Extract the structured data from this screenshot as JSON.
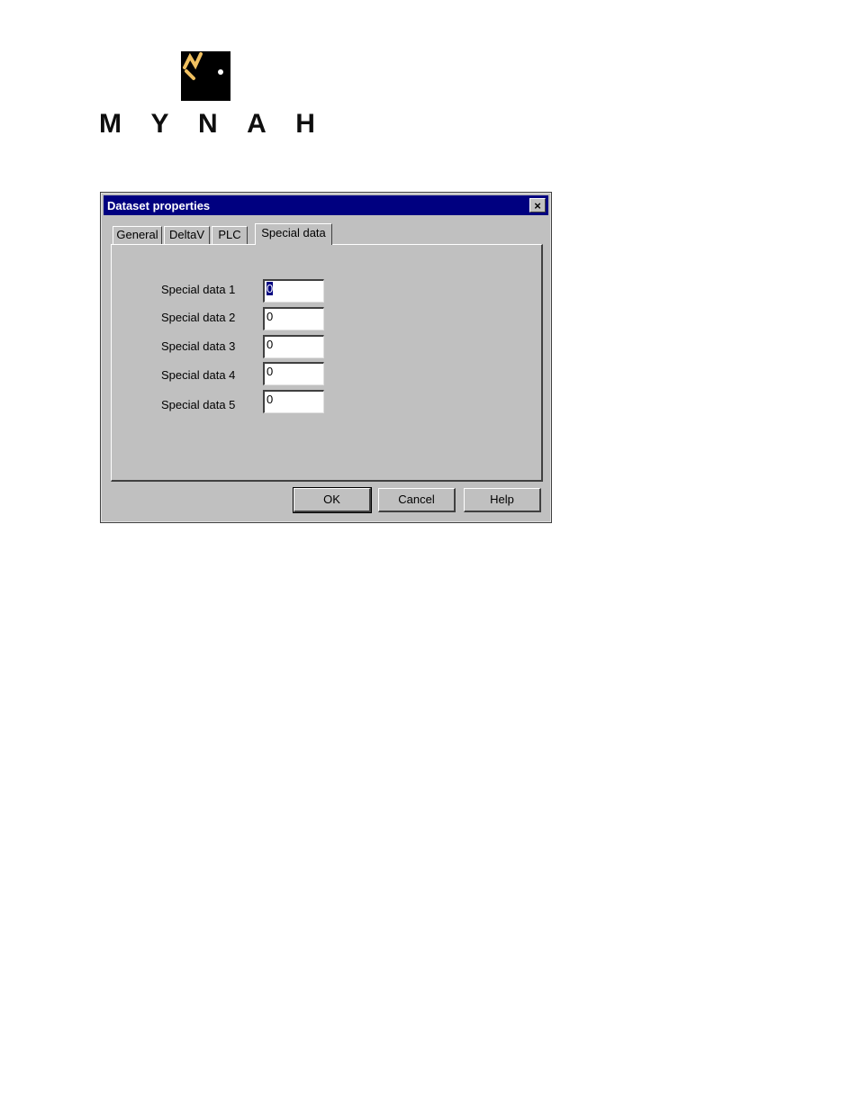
{
  "logo": {
    "wordmark": [
      "M",
      "Y",
      "N",
      "A",
      "H"
    ],
    "icon": "mynah-bird-logo-icon"
  },
  "dialog": {
    "title": "Dataset properties",
    "close_label": "×",
    "tabs": [
      {
        "label": "General",
        "active": false
      },
      {
        "label": "DeltaV",
        "active": false
      },
      {
        "label": "PLC",
        "active": false
      },
      {
        "label": "Special data",
        "active": true
      }
    ],
    "fields": [
      {
        "label": "Special data 1",
        "value": "0",
        "selected": true
      },
      {
        "label": "Special data 2",
        "value": "0",
        "selected": false
      },
      {
        "label": "Special data 3",
        "value": "0",
        "selected": false
      },
      {
        "label": "Special data 4",
        "value": "0",
        "selected": false
      },
      {
        "label": "Special data 5",
        "value": "0",
        "selected": false
      }
    ],
    "buttons": {
      "ok": "OK",
      "cancel": "Cancel",
      "help": "Help"
    }
  },
  "colors": {
    "titlebar": "#000080",
    "dialog_face": "#c0c0c0",
    "logo_accent": "#f0c060"
  }
}
